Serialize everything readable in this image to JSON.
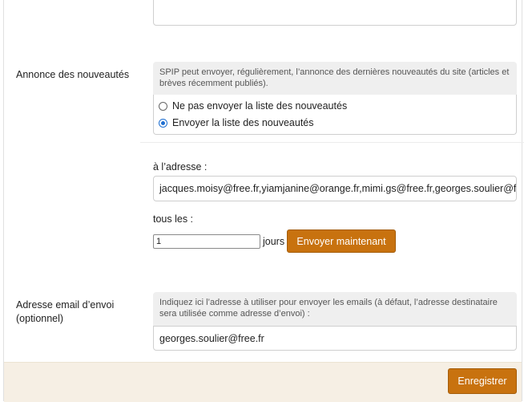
{
  "annonce": {
    "label": "Annonce des nouveautés",
    "explication": "SPIP peut envoyer, régulièrement, l’annonce des dernières nouveautés du site (articles et brèves récemment publiés).",
    "options": [
      {
        "label": "Ne pas envoyer la liste des nouveautés",
        "checked": false
      },
      {
        "label": "Envoyer la liste des nouveautés",
        "checked": true
      }
    ],
    "adresse_label": "à l’adresse :",
    "adresse_value": "jacques.moisy@free.fr,yiamjanine@orange.fr,mimi.gs@free.fr,georges.soulier@free.fr",
    "tous_les_label": "tous les :",
    "jours_value": "1",
    "jours_label": "jours",
    "send_now_label": "Envoyer maintenant"
  },
  "email_envoi": {
    "label_line1": "Adresse email d’envoi",
    "label_line2": "(optionnel)",
    "explication": "Indiquez ici l’adresse à utiliser pour envoyer les emails (à défaut, l’adresse destinataire sera utilisée comme adresse d’envoi) :",
    "value": "georges.soulier@free.fr"
  },
  "footer": {
    "save_label": "Enregistrer"
  },
  "colors": {
    "button": "#c8720f",
    "footer_bg": "#f6efe4",
    "radio_checked": "#1f6fd1"
  }
}
